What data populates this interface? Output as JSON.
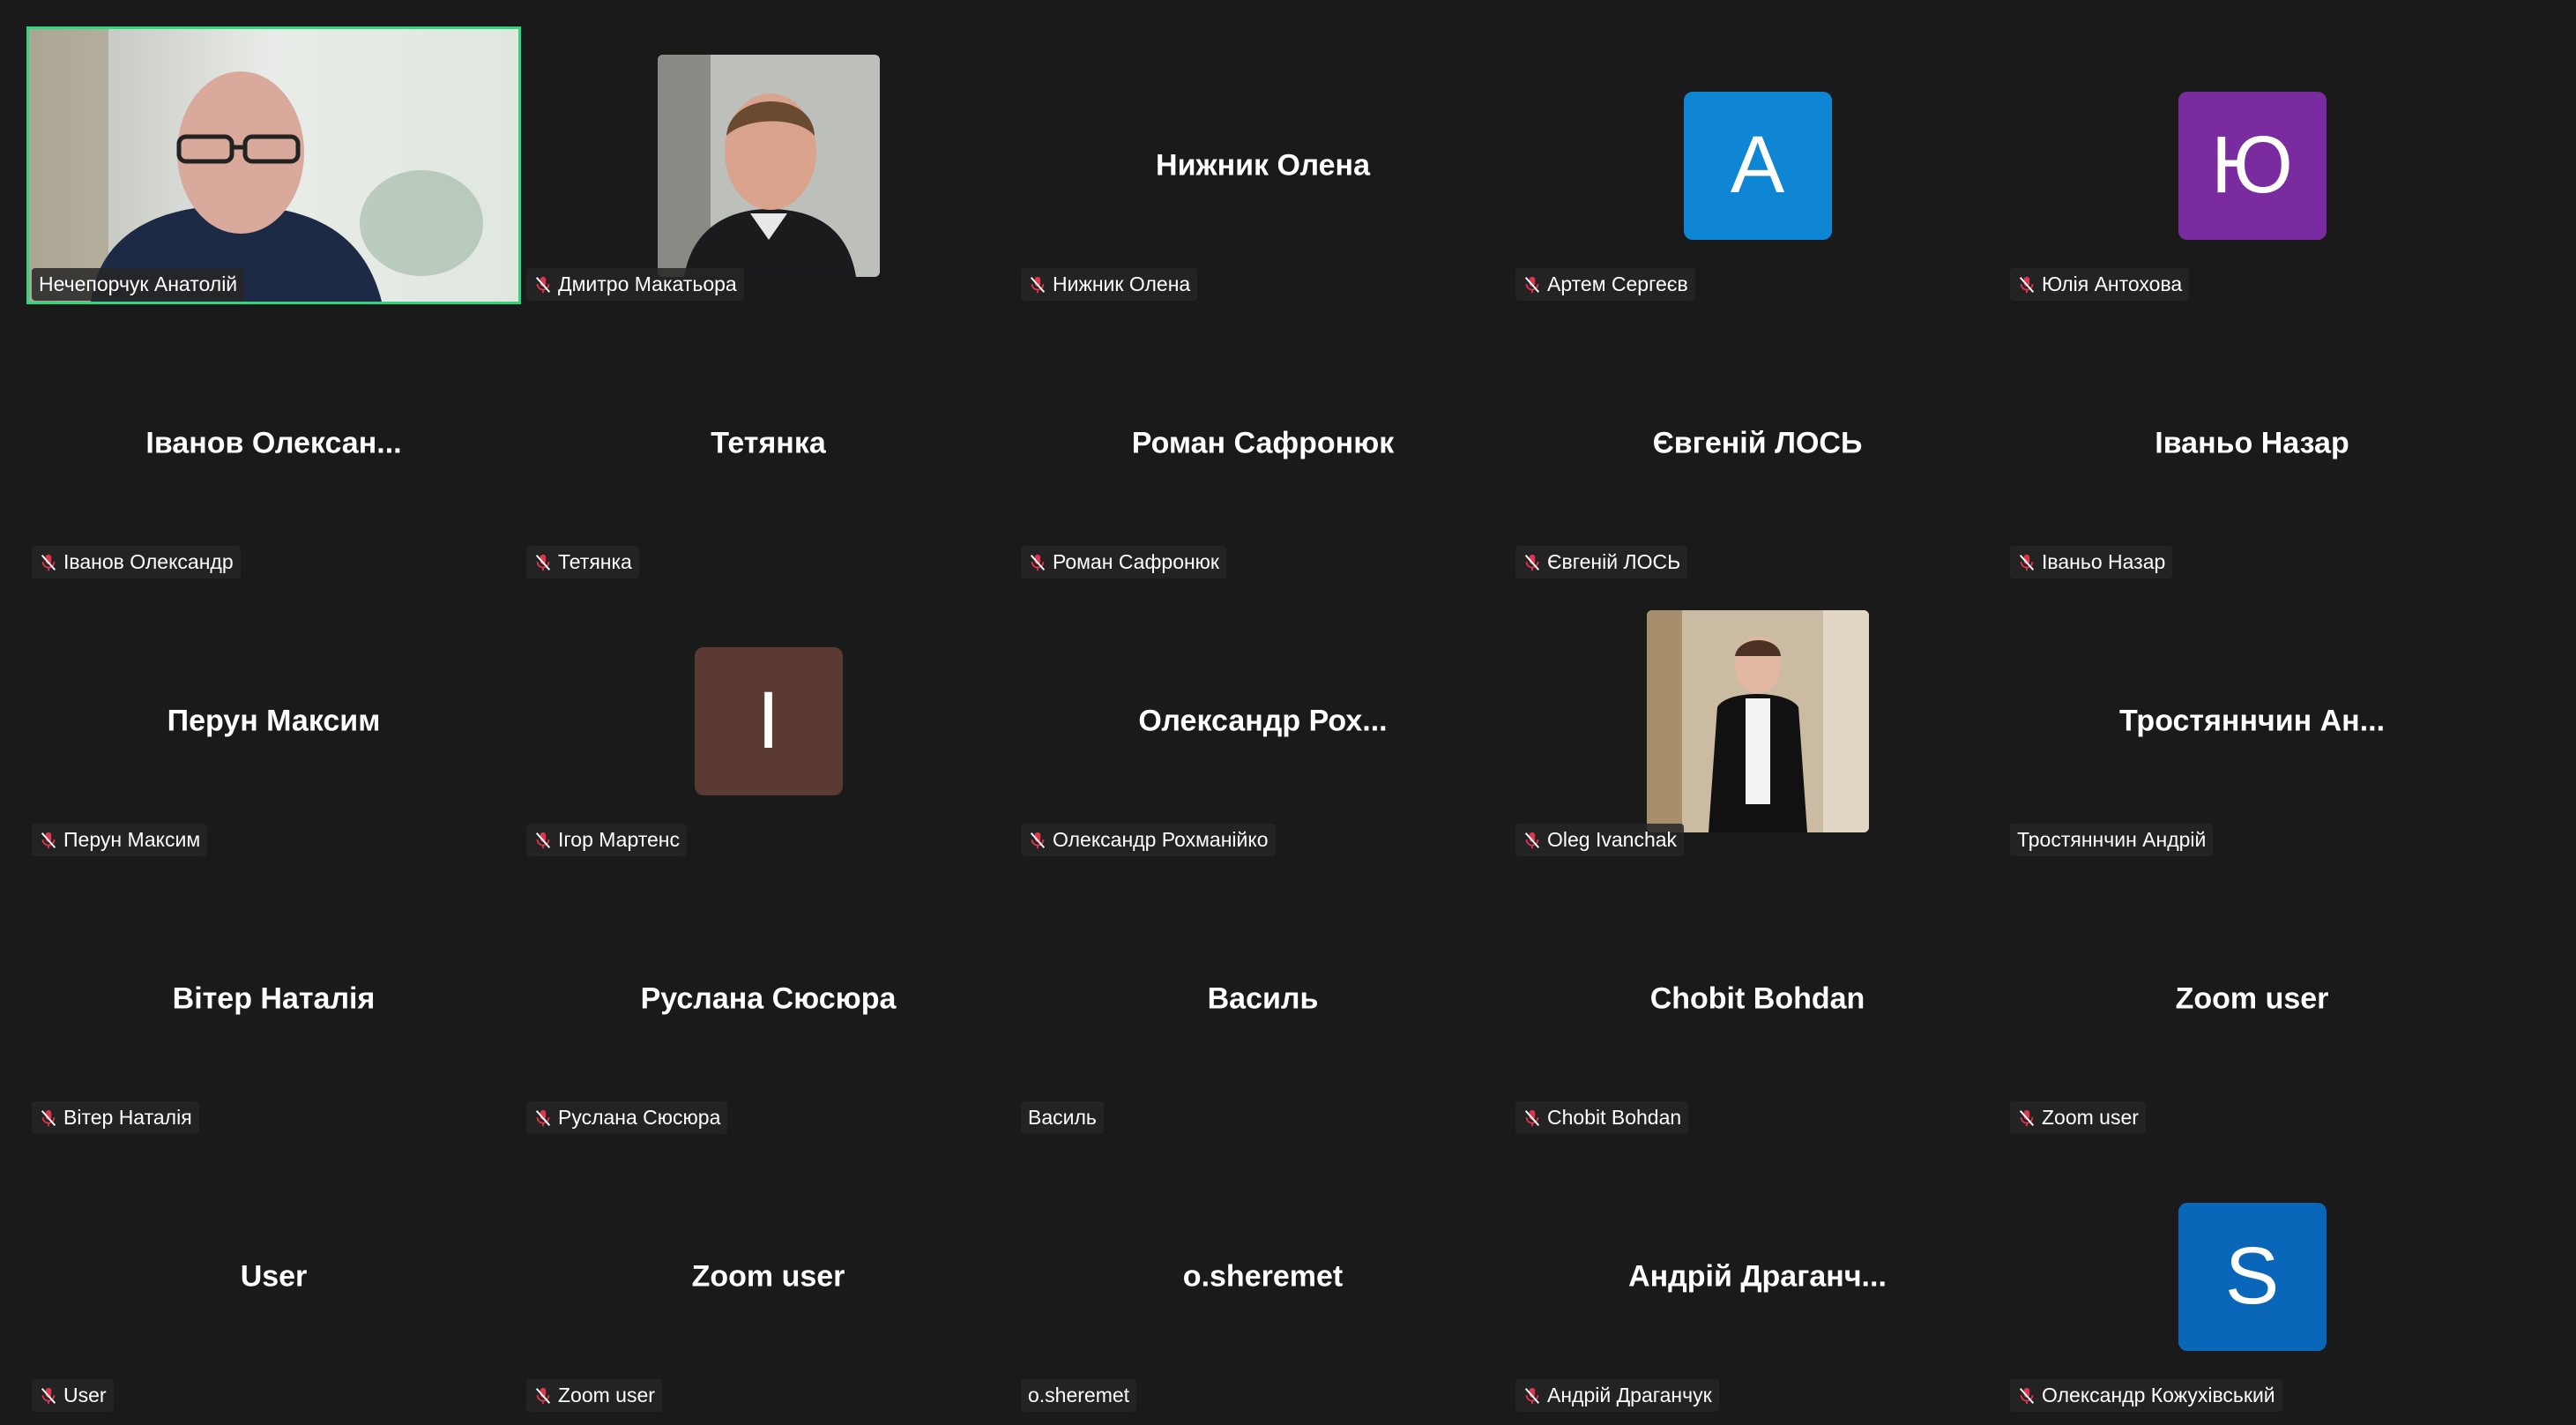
{
  "colors": {
    "background": "#1a1a1a",
    "active_speaker_border": "#2ed67e",
    "mute_icon": "#e0364d"
  },
  "participants": [
    {
      "tile_text": "",
      "label": "Нечепорчук Анатолій",
      "muted": false,
      "kind": "video",
      "active": true
    },
    {
      "tile_text": "",
      "label": "Дмитро Макатьора",
      "muted": true,
      "kind": "photo",
      "photo": "man-portrait"
    },
    {
      "tile_text": "Нижник Олена",
      "label": "Нижник Олена",
      "muted": true,
      "kind": "name"
    },
    {
      "tile_text": "A",
      "label": "Артем Сергеєв",
      "muted": true,
      "kind": "avatar",
      "color": "#0e86d4"
    },
    {
      "tile_text": "Ю",
      "label": "Юлія Антохова",
      "muted": true,
      "kind": "avatar",
      "color": "#7a2ba0"
    },
    {
      "tile_text": "Іванов Олексан...",
      "label": "Іванов Олександр",
      "muted": true,
      "kind": "name"
    },
    {
      "tile_text": "Тетянка",
      "label": "Тетянка",
      "muted": true,
      "kind": "name"
    },
    {
      "tile_text": "Роман Сафронюк",
      "label": "Роман Сафронюк",
      "muted": true,
      "kind": "name"
    },
    {
      "tile_text": "Євгеній ЛОСЬ",
      "label": "Євгеній ЛОСЬ",
      "muted": true,
      "kind": "name"
    },
    {
      "tile_text": "Іваньо Назар",
      "label": "Іваньо Назар",
      "muted": true,
      "kind": "name"
    },
    {
      "tile_text": "Перун Максим",
      "label": "Перун Максим",
      "muted": true,
      "kind": "name"
    },
    {
      "tile_text": "I",
      "label": "Ігор Мартенс",
      "muted": true,
      "kind": "avatar",
      "color": "#5a3a33"
    },
    {
      "tile_text": "Олександр Рох...",
      "label": "Олександр Рохманійко",
      "muted": true,
      "kind": "name"
    },
    {
      "tile_text": "",
      "label": "Oleg Ivanchak",
      "muted": true,
      "kind": "photo",
      "photo": "young-man"
    },
    {
      "tile_text": "Тростяннчин Ан...",
      "label": "Тростяннчин Андрій",
      "muted": false,
      "kind": "name"
    },
    {
      "tile_text": "Вітер Наталія",
      "label": "Вітер Наталія",
      "muted": true,
      "kind": "name"
    },
    {
      "tile_text": "Руслана Сюсюра",
      "label": "Руслана Сюсюра",
      "muted": true,
      "kind": "name"
    },
    {
      "tile_text": "Василь",
      "label": "Василь",
      "muted": false,
      "kind": "name"
    },
    {
      "tile_text": "Chobit Bohdan",
      "label": "Chobit Bohdan",
      "muted": true,
      "kind": "name"
    },
    {
      "tile_text": "Zoom user",
      "label": "Zoom user",
      "muted": true,
      "kind": "name"
    },
    {
      "tile_text": "User",
      "label": "User",
      "muted": true,
      "kind": "name"
    },
    {
      "tile_text": "Zoom user",
      "label": "Zoom user",
      "muted": true,
      "kind": "name"
    },
    {
      "tile_text": "o.sheremet",
      "label": "o.sheremet",
      "muted": false,
      "kind": "name"
    },
    {
      "tile_text": "Андрій Драганч...",
      "label": "Андрій Драганчук",
      "muted": true,
      "kind": "name"
    },
    {
      "tile_text": "S",
      "label": "Олександр Кожухівський",
      "muted": true,
      "kind": "avatar",
      "color": "#0a66b8"
    }
  ]
}
